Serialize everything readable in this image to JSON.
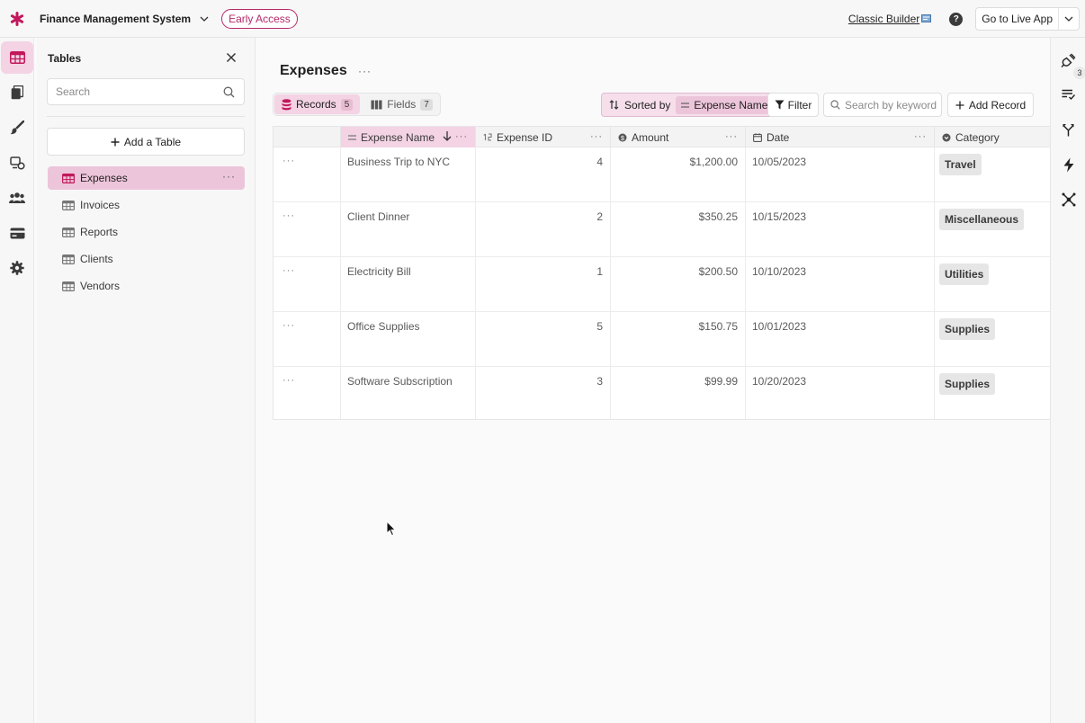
{
  "app": {
    "name": "Finance Management System",
    "badge": "Early Access",
    "classic_builder": "Classic Builder",
    "go_live": "Go to Live App",
    "accent": "#c2185b"
  },
  "rail": {
    "items": [
      "tables-icon",
      "pages-icon",
      "brush-icon",
      "automations-icon",
      "users-icon",
      "billing-icon",
      "settings-icon"
    ]
  },
  "tables_panel": {
    "title": "Tables",
    "search_placeholder": "Search",
    "add_table": "Add a Table",
    "items": [
      {
        "label": "Expenses",
        "active": true
      },
      {
        "label": "Invoices"
      },
      {
        "label": "Reports"
      },
      {
        "label": "Clients"
      },
      {
        "label": "Vendors"
      }
    ]
  },
  "main": {
    "title": "Expenses",
    "records_label": "Records",
    "records_count": "5",
    "fields_label": "Fields",
    "fields_count": "7",
    "sorted_by_label": "Sorted by",
    "sorted_field": "Expense Name",
    "filter_label": "Filter",
    "keyword_placeholder": "Search by keyword",
    "add_record": "Add Record"
  },
  "grid": {
    "columns": [
      "Expense Name",
      "Expense ID",
      "Amount",
      "Date",
      "Category"
    ],
    "rows": [
      {
        "name": "Business Trip to NYC",
        "id": "4",
        "amount": "$1,200.00",
        "date": "10/05/2023",
        "category": "Travel"
      },
      {
        "name": "Client Dinner",
        "id": "2",
        "amount": "$350.25",
        "date": "10/15/2023",
        "category": "Miscellaneous"
      },
      {
        "name": "Electricity Bill",
        "id": "1",
        "amount": "$200.50",
        "date": "10/10/2023",
        "category": "Utilities"
      },
      {
        "name": "Office Supplies",
        "id": "5",
        "amount": "$150.75",
        "date": "10/01/2023",
        "category": "Supplies"
      },
      {
        "name": "Software Subscription",
        "id": "3",
        "amount": "$99.99",
        "date": "10/20/2023",
        "category": "Supplies"
      }
    ]
  },
  "right_rail": {
    "badge": "3"
  }
}
